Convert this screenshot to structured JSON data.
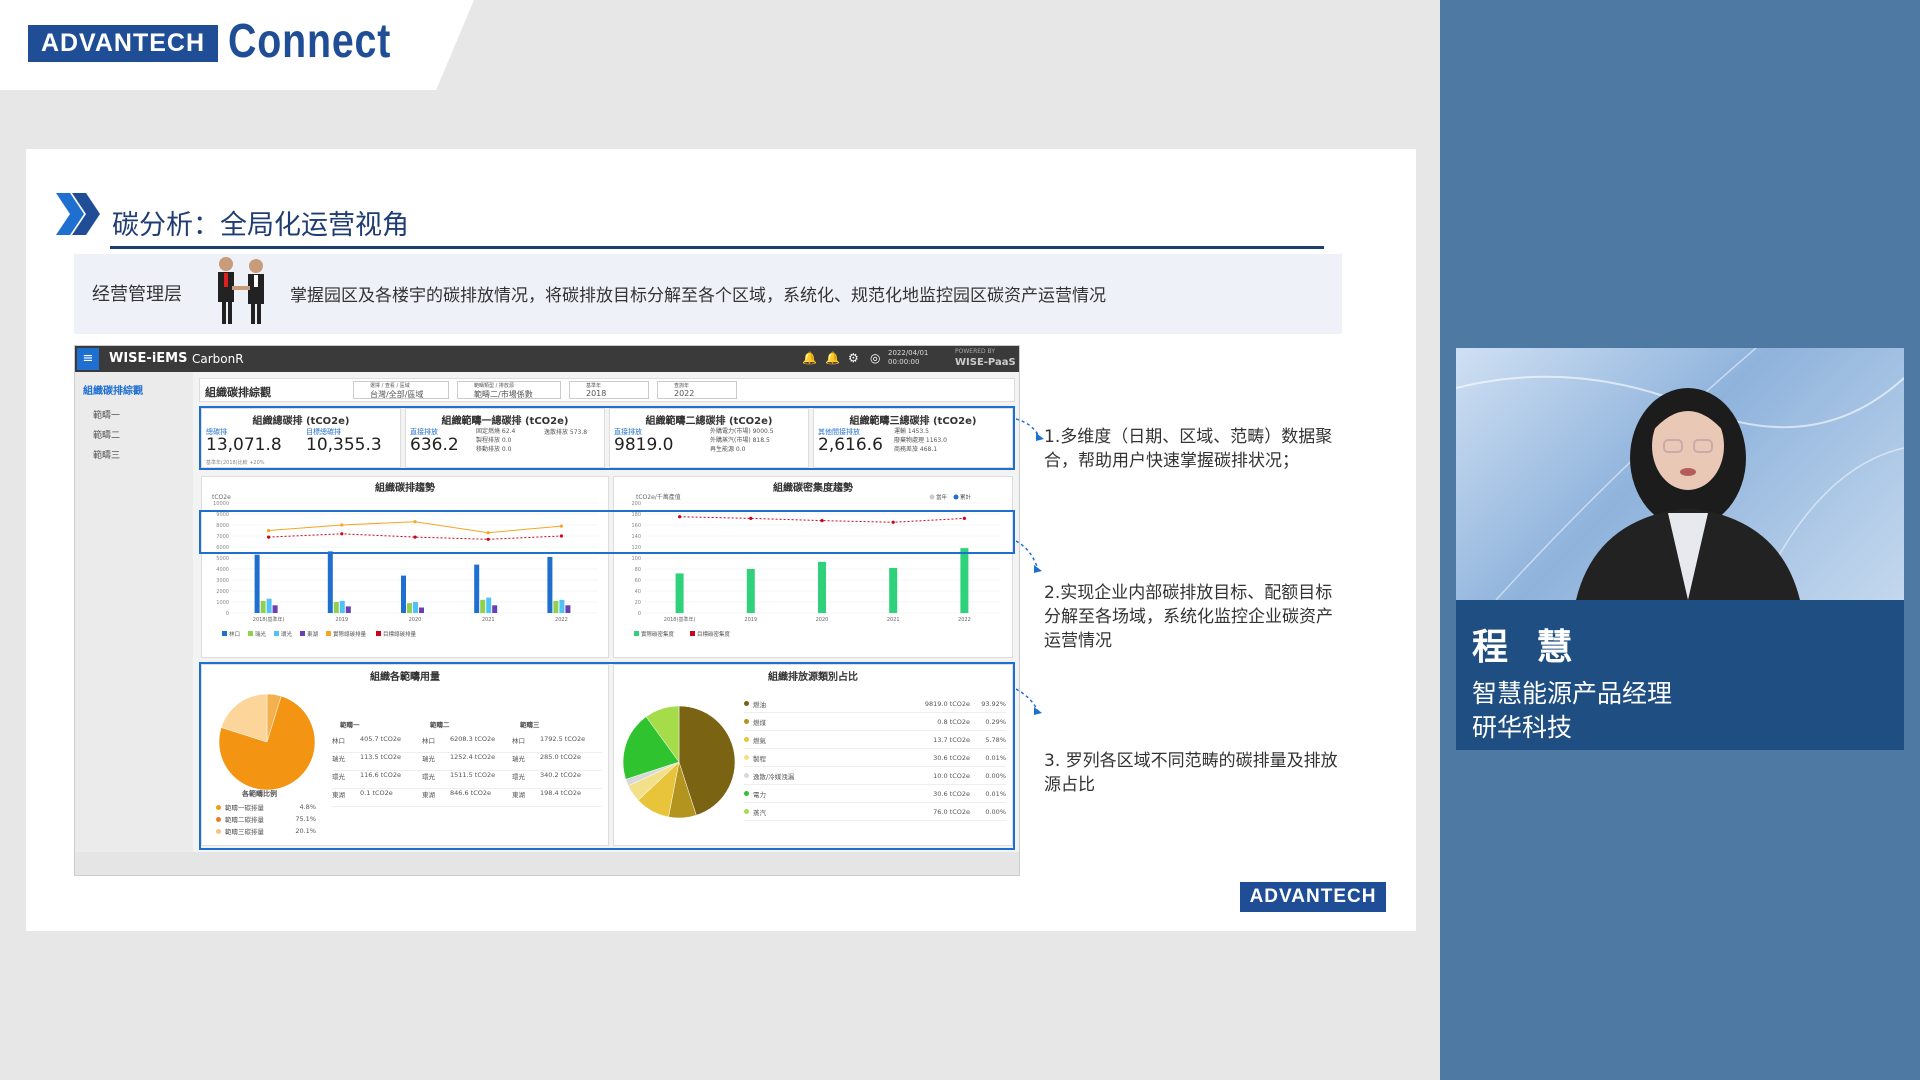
{
  "brand": {
    "logo_text": "ADVANTECH",
    "connect_text": "Connect"
  },
  "slide": {
    "title": "碳分析：全局化运营视角",
    "layer_label": "经营管理层",
    "description": "掌握园区及各楼宇的碳排放情况，将碳排放目标分解至各个区域，系统化、规范化地监控园区碳资产运营情况",
    "bottom_logo": "ADVANTECH"
  },
  "app": {
    "name": "WISE-iEMS",
    "module": "CarbonR",
    "datetime": "2022/04/01\n00:00:00",
    "powered_by": "POWERED BY",
    "powered_name": "WISE-PaaS",
    "sidebar": {
      "title": "組織碳排綜觀",
      "items": [
        "範疇一",
        "範疇二",
        "範疇三"
      ]
    },
    "page_title": "組織碳排綜觀",
    "filters": [
      {
        "caption": "選擇 / 查看 / 區域",
        "value": "台灣/全部/區域"
      },
      {
        "caption": "範疇類型 / 排放源",
        "value": "範疇二/市場係數"
      },
      {
        "caption": "基準年",
        "value": "2018"
      },
      {
        "caption": "查詢年",
        "value": "2022"
      }
    ],
    "kpis": [
      {
        "title": "組織總碳排 (tCO2e)",
        "l1": "總碳排",
        "v1": "13,071.8",
        "l2": "目標總碳排",
        "v2": "10,355.3",
        "foot": "基準年(2018)比較 +20%"
      },
      {
        "title": "組織範疇一總碳排 (tCO2e)",
        "l1": "直接排放",
        "v1": "636.2",
        "rows": [
          "固定燃燒  62.4",
          "製程排放  0.0",
          "移動排放  0.0",
          "逸散排放  573.8"
        ]
      },
      {
        "title": "組織範疇二總碳排 (tCO2e)",
        "l1": "直接排放",
        "v1": "9819.0",
        "rows": [
          "外購電力(市場)  9000.5",
          "外購蒸汽(市場)  818.5",
          "再生能源  0.0"
        ]
      },
      {
        "title": "組織範疇三總碳排 (tCO2e)",
        "l1": "其他間接排放",
        "v1": "2,616.6",
        "rows": [
          "運輸  1453.5",
          "廢棄物處理  1163.0",
          "商務差旅  468.1"
        ]
      }
    ],
    "chart_titles": {
      "trend": "組織碳排趨勢",
      "intensity": "組織碳密集度趨勢",
      "usage": "組織各範疇用量",
      "share": "組織排放源類別占比"
    },
    "trend_unit": "tCO2e",
    "intensity_unit": "tCO2e/千萬產值",
    "trend_legend": [
      "林口",
      "瑞光",
      "環光",
      "東湖",
      "實際總碳排量",
      "目標總碳排量"
    ],
    "intensity_legend": [
      "實際碳密集度",
      "目標碳密集度"
    ],
    "intensity_toggle": [
      "當年",
      "累計"
    ],
    "scope_share_title": "各範疇比例",
    "scope_share": [
      {
        "label": "範疇一碳排量",
        "value": "4.8%"
      },
      {
        "label": "範疇二碳排量",
        "value": "75.1%"
      },
      {
        "label": "範疇三碳排量",
        "value": "20.1%"
      }
    ],
    "scope_table": {
      "headers": [
        "範疇一",
        "範疇二",
        "範疇三"
      ],
      "rows": [
        [
          "林口",
          "405.7 tCO2e",
          "林口",
          "6208.3 tCO2e",
          "林口",
          "1792.5 tCO2e"
        ],
        [
          "瑞光",
          "113.5 tCO2e",
          "瑞光",
          "1252.4 tCO2e",
          "瑞光",
          "285.0 tCO2e"
        ],
        [
          "環光",
          "116.6 tCO2e",
          "環光",
          "1511.5 tCO2e",
          "環光",
          "340.2 tCO2e"
        ],
        [
          "東湖",
          "0.1 tCO2e",
          "東湖",
          "846.6 tCO2e",
          "東湖",
          "198.4 tCO2e"
        ]
      ]
    },
    "source_list": [
      {
        "name": "燃油",
        "value": "9819.0 tCO2e",
        "pct": "93.92%",
        "color": "#7a6313"
      },
      {
        "name": "燃煤",
        "value": "0.8 tCO2e",
        "pct": "0.29%",
        "color": "#b3941e"
      },
      {
        "name": "燃氣",
        "value": "13.7 tCO2e",
        "pct": "5.78%",
        "color": "#e8c43a"
      },
      {
        "name": "製程",
        "value": "30.6 tCO2e",
        "pct": "0.01%",
        "color": "#f3e08a"
      },
      {
        "name": "逸散/冷媒洩漏",
        "value": "10.0 tCO2e",
        "pct": "0.00%",
        "color": "#d9d9d9"
      },
      {
        "name": "電力",
        "value": "30.6 tCO2e",
        "pct": "0.01%",
        "color": "#2fc42f"
      },
      {
        "name": "蒸汽",
        "value": "76.0 tCO2e",
        "pct": "0.00%",
        "color": "#a5dc4a"
      }
    ]
  },
  "chart_data": [
    {
      "type": "bar",
      "title": "組織碳排趨勢",
      "ylabel": "tCO2e",
      "categories": [
        "2018(基準年)",
        "2019",
        "2020",
        "2021",
        "2022"
      ],
      "ylim": [
        0,
        10000
      ],
      "series": [
        {
          "name": "林口",
          "values": [
            5300,
            5600,
            3400,
            4400,
            5100
          ],
          "color": "#1f6fd1"
        },
        {
          "name": "瑞光",
          "values": [
            1100,
            1000,
            900,
            1200,
            1100
          ],
          "color": "#8fd14f"
        },
        {
          "name": "環光",
          "values": [
            1300,
            1100,
            1000,
            1400,
            1200
          ],
          "color": "#4fc3f7"
        },
        {
          "name": "東湖",
          "values": [
            700,
            600,
            500,
            700,
            700
          ],
          "color": "#6a3fb5"
        },
        {
          "name": "實際總碳排量",
          "values": [
            7500,
            8000,
            8300,
            7300,
            7900
          ],
          "color": "#f5a623"
        },
        {
          "name": "目標總碳排量",
          "values": [
            6900,
            7200,
            6900,
            6700,
            7000
          ],
          "color": "#d0021b"
        }
      ]
    },
    {
      "type": "bar",
      "title": "組織碳密集度趨勢",
      "ylabel": "tCO2e/千萬產值",
      "categories": [
        "2018(基準年)",
        "2019",
        "2020",
        "2021",
        "2022"
      ],
      "ylim": [
        0,
        200
      ],
      "series": [
        {
          "name": "實際碳密集度",
          "values": [
            72,
            80,
            93,
            82,
            118
          ],
          "color": "#2fd17a"
        },
        {
          "name": "目標碳密集度",
          "values": [
            175,
            172,
            168,
            165,
            172
          ],
          "color": "#d0021b"
        }
      ]
    },
    {
      "type": "pie",
      "title": "各範疇比例",
      "categories": [
        "範疇一碳排量",
        "範疇二碳排量",
        "範疇三碳排量"
      ],
      "values": [
        4.8,
        75.1,
        20.1
      ]
    },
    {
      "type": "pie",
      "title": "組織排放源類別占比",
      "categories": [
        "燃油",
        "燃煤",
        "燃氣",
        "製程",
        "逸散/冷媒洩漏",
        "電力",
        "蒸汽"
      ],
      "values": [
        45,
        8,
        10,
        5,
        2,
        20,
        10
      ]
    }
  ],
  "notes": [
    "1.多维度（日期、区域、范畴）数据聚合，帮助用户快速掌握碳排状况；",
    "2.实现企业内部碳排放目标、配额目标分解至各场域，系统化监控企业碳资产运营情况",
    "3. 罗列各区域不同范畴的碳排量及排放源占比"
  ],
  "presenter": {
    "name": "程 慧",
    "title": "智慧能源产品经理",
    "company": "研华科技"
  }
}
